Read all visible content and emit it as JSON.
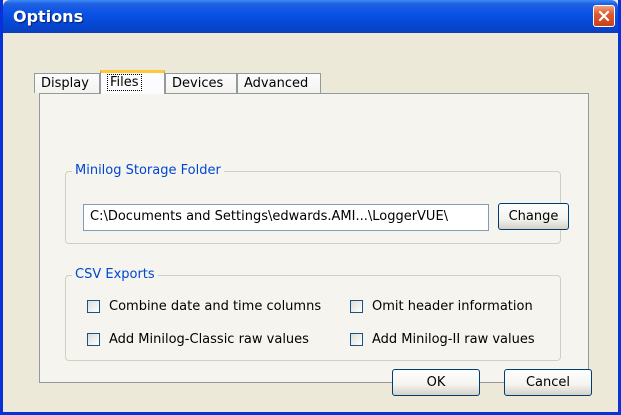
{
  "window": {
    "title": "Options"
  },
  "tabs": [
    {
      "label": "Display",
      "active": false
    },
    {
      "label": "Files",
      "active": true
    },
    {
      "label": "Devices",
      "active": false
    },
    {
      "label": "Advanced",
      "active": false
    }
  ],
  "storage": {
    "group_label": "Minilog Storage Folder",
    "path_value": "C:\\Documents and Settings\\edwards.AMI...\\LoggerVUE\\",
    "change_label": "Change"
  },
  "csv": {
    "group_label": "CSV Exports",
    "options": [
      {
        "label": "Combine date and time columns",
        "checked": false
      },
      {
        "label": "Omit header information",
        "checked": false
      },
      {
        "label": "Add Minilog-Classic raw values",
        "checked": false
      },
      {
        "label": "Add Minilog-II raw values",
        "checked": false
      }
    ]
  },
  "footer": {
    "ok_label": "OK",
    "cancel_label": "Cancel"
  },
  "colors": {
    "titlebar": "#0a53e6",
    "group_label": "#0046d5",
    "active_tab_accent": "#ffc83c",
    "close_button": "#e05a30"
  },
  "icons": {
    "close": "close-icon"
  }
}
